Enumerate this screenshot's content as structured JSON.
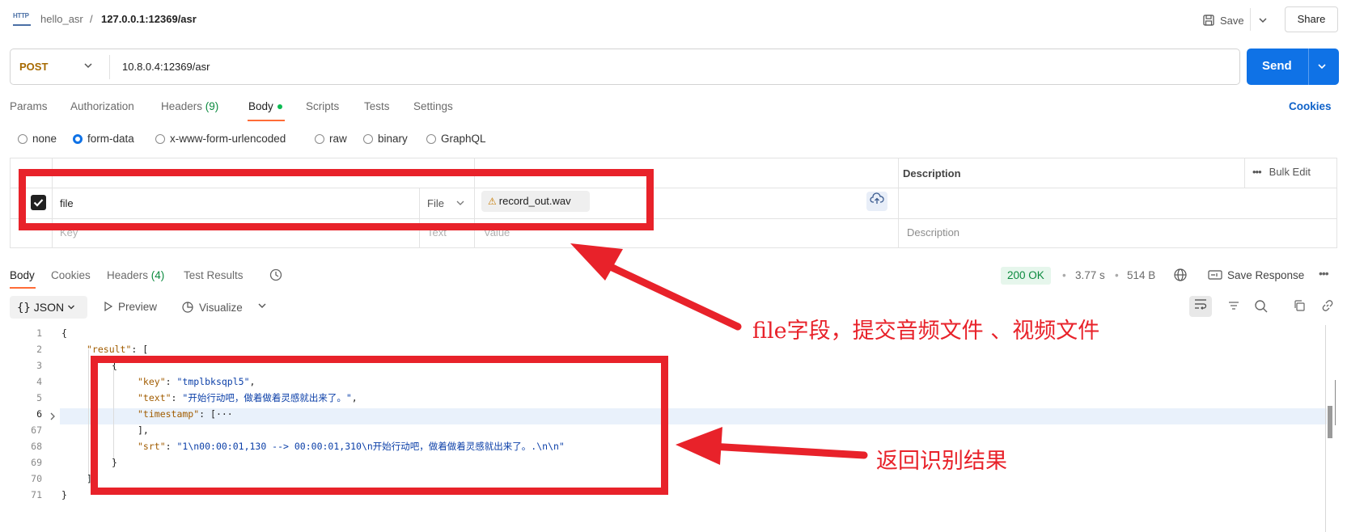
{
  "breadcrumb": {
    "collection": "hello_asr",
    "separator": "/",
    "request_name": "127.0.0.1:12369/asr",
    "http_icon_text": "HTTP"
  },
  "toolbar_top": {
    "save_label": "Save",
    "share_label": "Share"
  },
  "request": {
    "method": "POST",
    "url": "10.8.0.4:12369/asr",
    "send_label": "Send"
  },
  "request_tabs": {
    "params": "Params",
    "authorization": "Authorization",
    "headers": "Headers",
    "headers_count": "(9)",
    "body": "Body",
    "scripts": "Scripts",
    "tests": "Tests",
    "settings": "Settings",
    "cookies": "Cookies",
    "active": "Body"
  },
  "body_types": {
    "none": "none",
    "form_data": "form-data",
    "urlencoded": "x-www-form-urlencoded",
    "raw": "raw",
    "binary": "binary",
    "graphql": "GraphQL",
    "selected": "form-data"
  },
  "form_table": {
    "description_header": "Description",
    "bulk_edit": "Bulk Edit",
    "rows": [
      {
        "checked": true,
        "key": "file",
        "type": "File",
        "value": "record_out.wav"
      }
    ],
    "new_row": {
      "key_placeholder": "Key",
      "type": "Text",
      "value_placeholder": "Value",
      "description_placeholder": "Description"
    }
  },
  "response_tabs": {
    "body": "Body",
    "cookies": "Cookies",
    "headers": "Headers",
    "headers_count": "(4)",
    "test_results": "Test Results",
    "active": "Body"
  },
  "response_meta": {
    "status": "200 OK",
    "time": "3.77 s",
    "size": "514 B",
    "save_response": "Save Response"
  },
  "response_toolbar": {
    "format": "JSON",
    "preview": "Preview",
    "visualize": "Visualize"
  },
  "code_lines": [
    {
      "n": "1",
      "text": "{"
    },
    {
      "n": "2",
      "key": "\"result\"",
      "rest": ": ["
    },
    {
      "n": "3",
      "text": "{"
    },
    {
      "n": "4",
      "key": "\"key\"",
      "sep": ": ",
      "val": "\"tmplbksqpl5\"",
      "tail": ","
    },
    {
      "n": "5",
      "key": "\"text\"",
      "sep": ": ",
      "val": "\"开始行动吧，做着做着灵感就出来了。\"",
      "tail": ","
    },
    {
      "n": "6",
      "key": "\"timestamp\"",
      "sep": ": ",
      "val": "[···"
    },
    {
      "n": "67",
      "text": "],"
    },
    {
      "n": "68",
      "key": "\"srt\"",
      "sep": ": ",
      "val": "\"1\\n00:00:01,130 --> 00:00:01,310\\n开始行动吧，做着做着灵感就出来了。.\\n\\n\""
    },
    {
      "n": "69",
      "text": "}"
    },
    {
      "n": "70",
      "text": "]"
    },
    {
      "n": "71",
      "text": "}"
    }
  ],
  "annotations": {
    "file_note": "file字段，提交音频文件 、视频文件",
    "result_note": "返回识别结果",
    "color": "#e8222a"
  },
  "colors": {
    "send_button": "#0f72e6",
    "active_tab_underline": "#ff6c37",
    "status_ok": "#0b8a3e",
    "method_post": "#a76a00"
  }
}
